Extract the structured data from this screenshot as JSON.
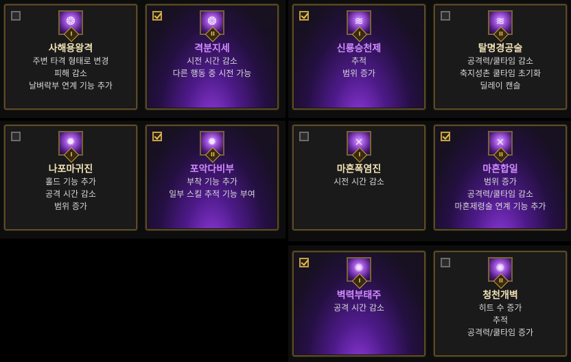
{
  "cards": [
    {
      "name": "사해용왕격",
      "rank": "I",
      "selected": false,
      "glyph": "❂",
      "lines": [
        "주변 타격 형태로 변경",
        "피해 감소",
        "날벼락부 연계 기능 추가"
      ]
    },
    {
      "name": "격분지세",
      "rank": "II",
      "selected": true,
      "glyph": "❂",
      "lines": [
        "시전 시간 감소",
        "다른 행동 중 시전 가능"
      ]
    },
    {
      "name": "신룡승천제",
      "rank": "I",
      "selected": true,
      "glyph": "≋",
      "lines": [
        "추적",
        "범위 증가"
      ]
    },
    {
      "name": "탈명경공술",
      "rank": "II",
      "selected": false,
      "glyph": "≋",
      "lines": [
        "공격력/쿨타임 감소",
        "축지성촌 쿨타임 초기화",
        "딜레이 캔슬"
      ]
    },
    {
      "name": "나포마귀진",
      "rank": "I",
      "selected": false,
      "glyph": "✹",
      "lines": [
        "홀드 기능 추가",
        "공격 시간 감소",
        "범위 증가"
      ]
    },
    {
      "name": "포악다비부",
      "rank": "II",
      "selected": true,
      "glyph": "✹",
      "lines": [
        "부착 기능 추가",
        "일부 스킬 추적 기능 부여"
      ]
    },
    {
      "name": "마혼폭염진",
      "rank": "I",
      "selected": false,
      "glyph": "⨯",
      "lines": [
        "시전 시간 감소"
      ]
    },
    {
      "name": "마혼합일",
      "rank": "II",
      "selected": true,
      "glyph": "⨯",
      "lines": [
        "범위 증가",
        "공격력/쿨타임 감소",
        "마혼제령술 연계 기능 추가"
      ]
    },
    {
      "name": "벽력부태주",
      "rank": "I",
      "selected": true,
      "glyph": "✺",
      "lines": [
        "공격 시간 감소"
      ]
    },
    {
      "name": "청천개벽",
      "rank": "II",
      "selected": false,
      "glyph": "✺",
      "lines": [
        "히트 수 증가",
        "추적",
        "공격력/쿨타임 증가"
      ]
    }
  ]
}
